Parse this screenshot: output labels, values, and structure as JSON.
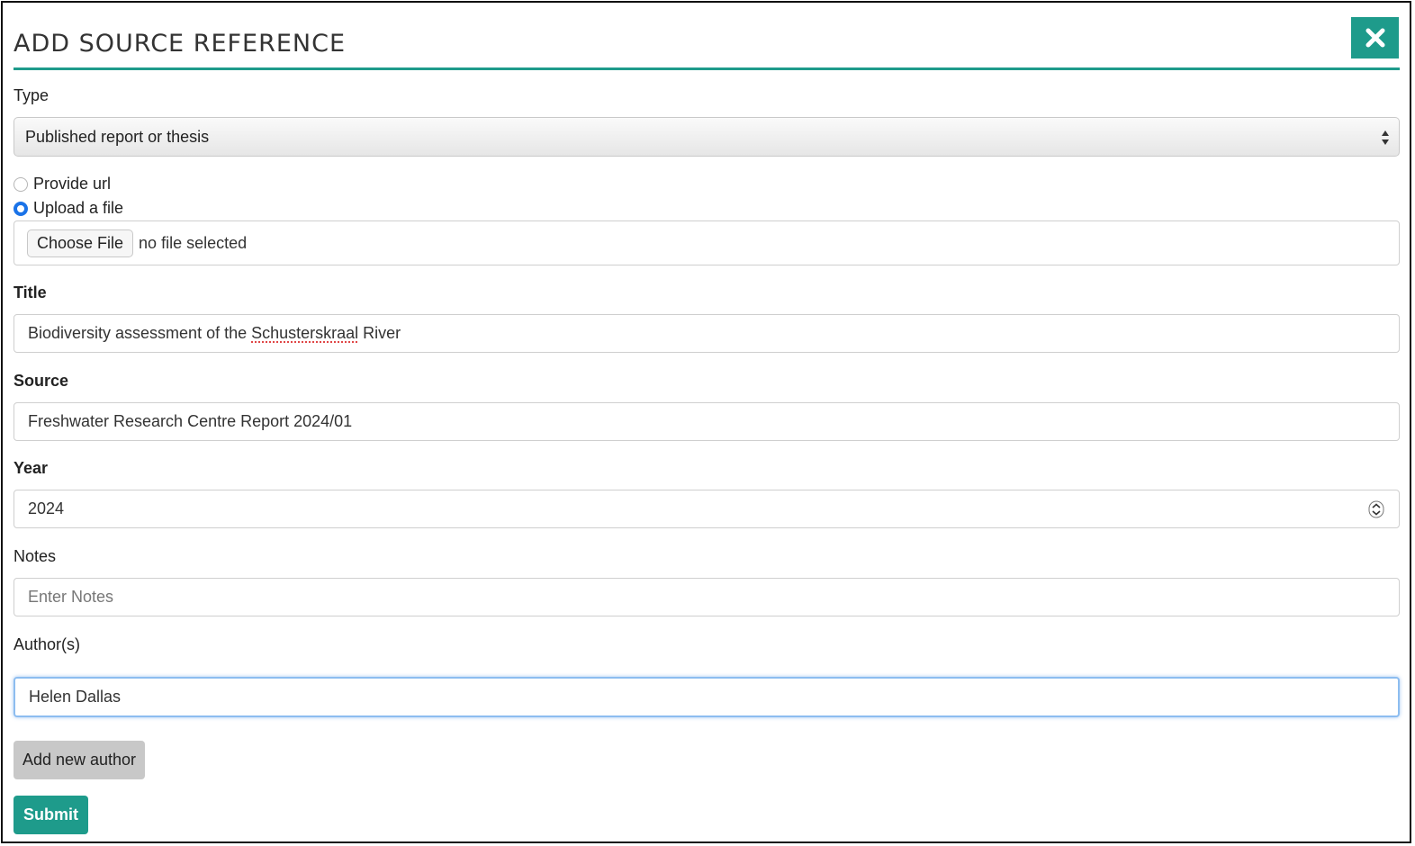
{
  "modal": {
    "title": "ADD SOURCE REFERENCE",
    "accent_color": "#1e9b8b"
  },
  "form": {
    "type_label": "Type",
    "type_value": "Published report or thesis",
    "radio_provide_url": "Provide url",
    "radio_upload_file": "Upload a file",
    "selected_option": "Upload a file",
    "file_button": "Choose File",
    "file_status": "no file selected",
    "title_label": "Title",
    "title_value_part1": "Biodiversity assessment of the ",
    "title_value_misspelled": "Schusterskraal",
    "title_value_part2": " River",
    "source_label": "Source",
    "source_value": "Freshwater Research Centre Report 2024/01",
    "year_label": "Year",
    "year_value": "2024",
    "notes_label": "Notes",
    "notes_placeholder": "Enter Notes",
    "authors_label": "Author(s)",
    "authors_value": "Helen Dallas",
    "add_author_button": "Add new author",
    "submit_button": "Submit"
  }
}
